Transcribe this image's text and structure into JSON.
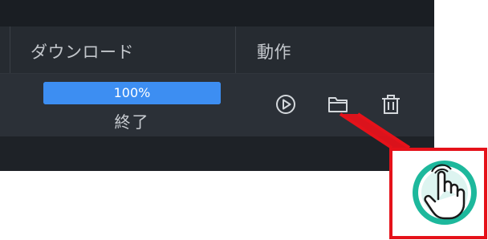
{
  "table": {
    "headers": {
      "download": "ダウンロード",
      "action": "動作"
    },
    "rows": [
      {
        "progress_percent": 100,
        "progress_label": "100%",
        "status": "終了",
        "actions": [
          "play-icon",
          "folder-icon",
          "trash-icon"
        ]
      }
    ]
  },
  "colors": {
    "panel_background": "#1f2329",
    "header_background": "#262b31",
    "row_background": "#2b3037",
    "progress_blue": "#3d8ef2",
    "callout_red": "#e5121a",
    "hand_teal": "#1db89c"
  },
  "callout": {
    "target": "folder-icon",
    "icon": "hand-pointer-icon"
  }
}
